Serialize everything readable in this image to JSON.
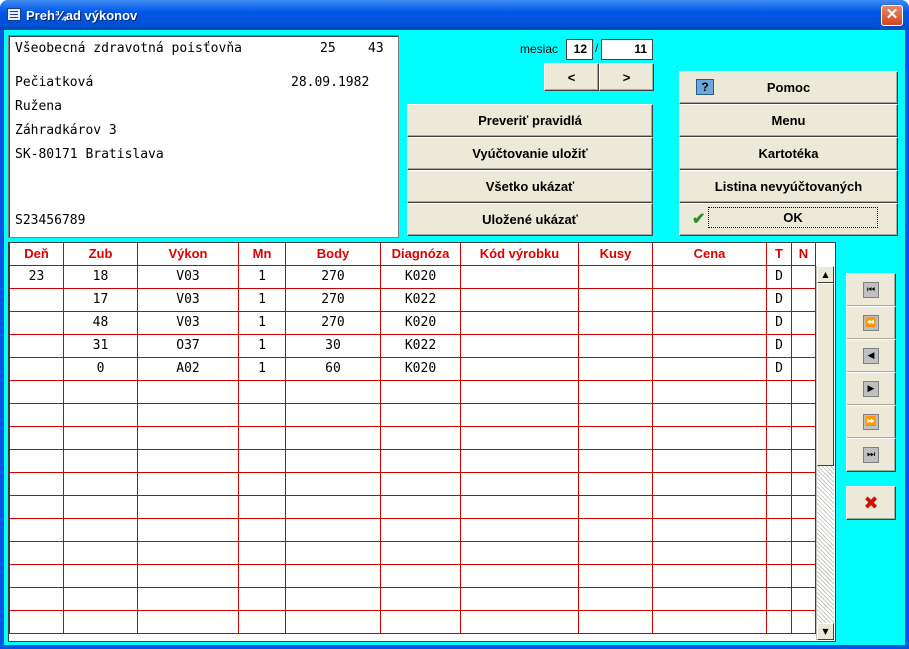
{
  "window": {
    "title": "Preh¾ad výkonov",
    "close": "✕"
  },
  "patient": {
    "insurer": "Všeobecná zdravotná poisťovňa",
    "insurer_code1": "25",
    "insurer_code2": "43",
    "surname": "Pečiatková",
    "dob": "28.09.1982",
    "firstname": "Ružena",
    "street": "Záhradkárov 3",
    "city": "SK-80171 Bratislava",
    "id": "S23456789"
  },
  "month": {
    "label": "mesiac",
    "month": "12",
    "sep": "/",
    "year": "11",
    "prev": "<",
    "next": ">"
  },
  "actions": {
    "check_rules": "Preveriť pravidlá",
    "save_billing": "Vyúčtovanie uložiť",
    "show_all": "Všetko ukázať",
    "show_saved": "Uložené ukázať"
  },
  "right_menu": {
    "help_icon": "?",
    "help": "Pomoc",
    "menu": "Menu",
    "card_index": "Kartotéka",
    "unbilled_list": "Listina nevyúčtovaných",
    "ok": "OK"
  },
  "table": {
    "columns": [
      "Deň",
      "Zub",
      "Výkon",
      "Mn",
      "Body",
      "Diagnóza",
      "Kód výrobku",
      "Kusy",
      "Cena",
      "T",
      "N"
    ],
    "rows": [
      [
        "23",
        "18",
        "V03",
        "1",
        "270",
        "K020",
        "",
        "",
        "",
        "D",
        ""
      ],
      [
        "",
        "17",
        "V03",
        "1",
        "270",
        "K022",
        "",
        "",
        "",
        "D",
        ""
      ],
      [
        "",
        "48",
        "V03",
        "1",
        "270",
        "K020",
        "",
        "",
        "",
        "D",
        ""
      ],
      [
        "",
        "31",
        "O37",
        "1",
        "30",
        "K022",
        "",
        "",
        "",
        "D",
        ""
      ],
      [
        "",
        "0",
        "A02",
        "1",
        "60",
        "K020",
        "",
        "",
        "",
        "D",
        ""
      ]
    ],
    "empty_rows": 11
  },
  "nav": {
    "first": "⏮",
    "prev_page": "⏪",
    "prev": "◀",
    "next": "▶",
    "next_page": "⏩",
    "last": "⏭",
    "delete": "✖"
  },
  "colors": {
    "client_bg": "#00ffff",
    "header_text": "#e00000",
    "grid_line": "#d00000",
    "delete_icon": "#d01010"
  }
}
